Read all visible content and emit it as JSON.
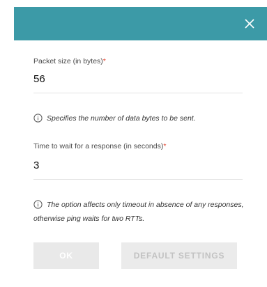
{
  "dialog": {
    "header_color": "#3c9aa7",
    "close_icon": "close-icon"
  },
  "fields": {
    "packet_size": {
      "label": "Packet size (in bytes)",
      "required_mark": "*",
      "value": "56",
      "hint": "Specifies the number of data bytes to be sent."
    },
    "timeout": {
      "label": "Time to wait for a response (in seconds)",
      "required_mark": "*",
      "value": "3",
      "hint": "The option affects only timeout in absence of any responses, otherwise ping waits for two RTTs."
    }
  },
  "buttons": {
    "ok_label": "OK",
    "default_label": "DEFAULT SETTINGS"
  }
}
